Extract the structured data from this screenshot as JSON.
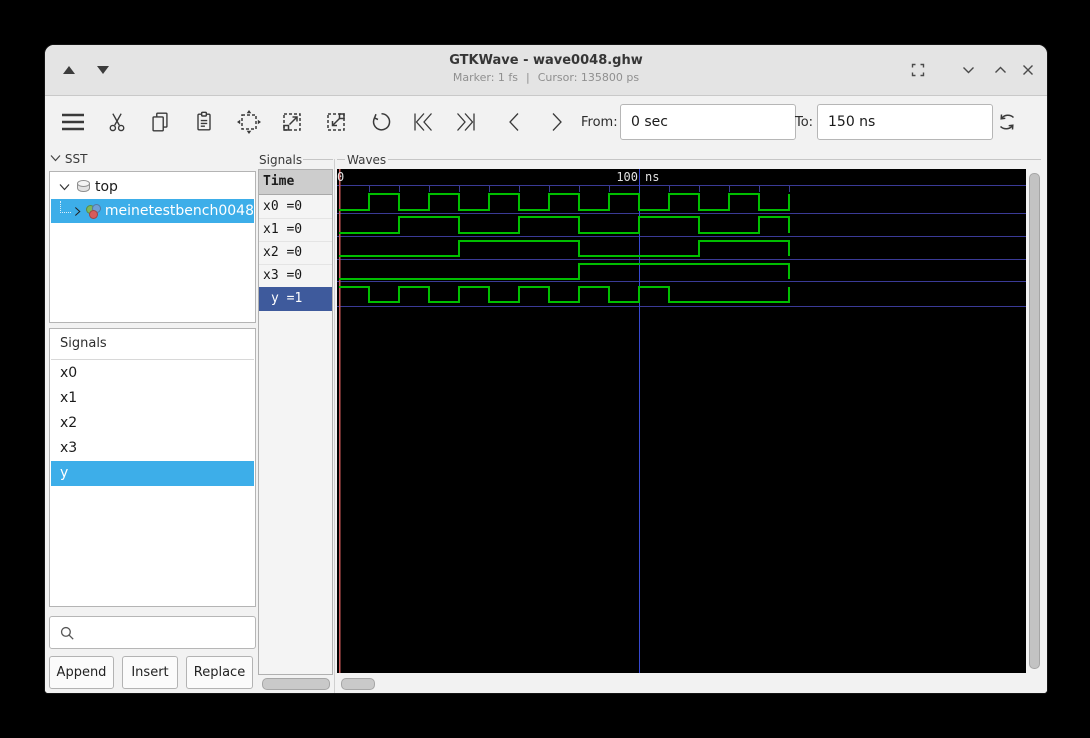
{
  "window": {
    "title": "GTKWave - wave0048.ghw",
    "subtitle_marker": "Marker: 1 fs",
    "subtitle_sep": "|",
    "subtitle_cursor": "Cursor: 135800 ps"
  },
  "toolbar": {
    "from_label": "From:",
    "from_value": "0 sec",
    "to_label": "To:",
    "to_value": "150 ns"
  },
  "sst_panel": {
    "frame_label": "SST",
    "root_label": "top",
    "child_label": "meinetestbench0048"
  },
  "facility_panel": {
    "header": "Signals",
    "items": [
      "x0",
      "x1",
      "x2",
      "x3",
      "y"
    ],
    "selected_item": "y",
    "search_value": "",
    "append_label": "Append",
    "insert_label": "Insert",
    "replace_label": "Replace"
  },
  "signals_panel": {
    "frame_label": "Signals",
    "time_header": "Time",
    "rows": [
      {
        "label": "x0 =0"
      },
      {
        "label": "x1 =0"
      },
      {
        "label": "x2 =0"
      },
      {
        "label": "x3 =0"
      },
      {
        "label": "y =1"
      }
    ]
  },
  "waves_panel": {
    "frame_label": "Waves"
  },
  "colors": {
    "selection_blue": "#3daee9",
    "signal_row_selected": "#3e5a9c",
    "wave_green": "#00be00",
    "grid_blue": "#3a3a96",
    "cursor_blue": "#3648d0",
    "marker_red": "#d05b5b",
    "canvas_black": "#000000",
    "timeline_text": "#e2e2e2"
  },
  "chart_data": {
    "type": "digital-waveform",
    "time_unit": "ns",
    "t_start": 0,
    "t_end": 150,
    "tick_interval_ns": 10,
    "timeline_labels": [
      {
        "t": 0,
        "label": "0"
      },
      {
        "t": 100,
        "label": "100",
        "unit": "ns"
      }
    ],
    "cursor_t_ns": 100,
    "marker_t_ns": 0,
    "marker_time_text": "1 fs",
    "cursor_time_text": "135800 ps",
    "signals": [
      {
        "name": "x0",
        "value_at_marker": 0,
        "initial": 0,
        "toggle_times": [
          10,
          20,
          30,
          40,
          50,
          60,
          70,
          80,
          90,
          100,
          110,
          120,
          130,
          140
        ]
      },
      {
        "name": "x1",
        "value_at_marker": 0,
        "initial": 0,
        "toggle_times": [
          20,
          40,
          60,
          80,
          100,
          120,
          140
        ]
      },
      {
        "name": "x2",
        "value_at_marker": 0,
        "initial": 0,
        "toggle_times": [
          40,
          80,
          120
        ]
      },
      {
        "name": "x3",
        "value_at_marker": 0,
        "initial": 0,
        "toggle_times": [
          80
        ]
      },
      {
        "name": "y",
        "value_at_marker": 1,
        "initial": 1,
        "toggle_times": [
          10,
          20,
          30,
          40,
          50,
          60,
          70,
          80,
          90,
          100,
          110
        ]
      }
    ]
  }
}
